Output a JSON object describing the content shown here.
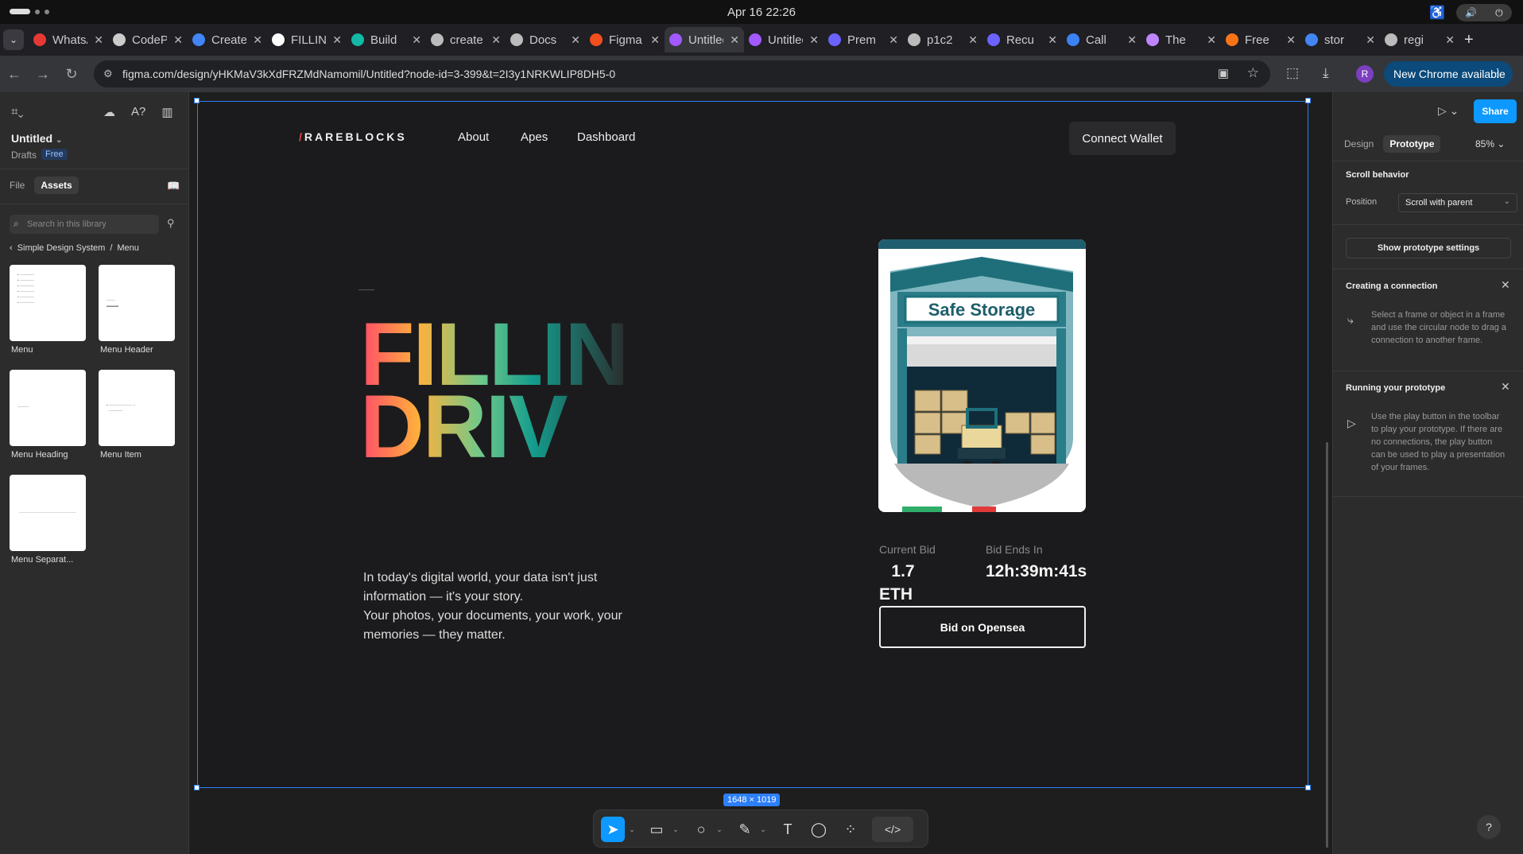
{
  "os": {
    "clock": "Apr 16  22:26"
  },
  "browser": {
    "tabs": [
      {
        "title": "WhatsApp",
        "color": "#e53935"
      },
      {
        "title": "CodePen",
        "color": "#cccccc"
      },
      {
        "title": "Create",
        "color": "#4285f4"
      },
      {
        "title": "FILLIN",
        "color": "#ffffff"
      },
      {
        "title": "Build",
        "color": "#14b8a6"
      },
      {
        "title": "create",
        "color": "#bbbbbb"
      },
      {
        "title": "Docs",
        "color": "#bbbbbb"
      },
      {
        "title": "Figma",
        "color": "#f24e1e"
      },
      {
        "title": "Untitled",
        "color": "#a259ff"
      },
      {
        "title": "Untitled",
        "color": "#a259ff"
      },
      {
        "title": "Prem",
        "color": "#6c63ff"
      },
      {
        "title": "p1c2",
        "color": "#bbbbbb"
      },
      {
        "title": "Recu",
        "color": "#6c63ff"
      },
      {
        "title": "Call",
        "color": "#3b82f6"
      },
      {
        "title": "The",
        "color": "#c084fc"
      },
      {
        "title": "Free",
        "color": "#f97316"
      },
      {
        "title": "stor",
        "color": "#4285f4"
      },
      {
        "title": "regi",
        "color": "#bbbbbb"
      }
    ],
    "active_tab_index": 8,
    "url": "figma.com/design/yHKMaV3kXdFRZMdNamomil/Untitled?node-id=3-399&t=2I3y1NRKWLIP8DH5-0",
    "avatar_letter": "R",
    "new_chrome_label": "New Chrome available"
  },
  "left_panel": {
    "file_name": "Untitled",
    "drafts_label": "Drafts",
    "plan_badge": "Free",
    "tab_file": "File",
    "tab_assets": "Assets",
    "search_placeholder": "Search in this library",
    "breadcrumb_lib": "Simple Design System",
    "breadcrumb_sep": "/",
    "breadcrumb_page": "Menu",
    "assets": [
      {
        "label": "Menu"
      },
      {
        "label": "Menu Header"
      },
      {
        "label": "Menu Heading"
      },
      {
        "label": "Menu Item"
      },
      {
        "label": "Menu Separat..."
      }
    ]
  },
  "design": {
    "brand_slash": "/",
    "brand": "RAREBLOCKS",
    "nav": [
      "About",
      "Apes",
      "Dashboard"
    ],
    "wallet_button": "Connect Wallet",
    "hero_line1": "FILLIN",
    "hero_line2": "DRIV",
    "hero_text": "In today's digital world, your data isn't just information — it's your story.\nYour photos, your documents, your work, your memories — they matter.",
    "nft_title": "Safe Storage",
    "current_bid_label": "Current Bid",
    "current_bid_value_1": "1.7",
    "current_bid_value_2": "ETH",
    "bid_ends_label": "Bid Ends In",
    "bid_ends_value": "12h:39m:41s",
    "bid_button": "Bid on Opensea",
    "frame_size": "1648 × 1019"
  },
  "right_panel": {
    "share_button": "Share",
    "tab_design": "Design",
    "tab_prototype": "Prototype",
    "zoom": "85%",
    "scroll_heading": "Scroll behavior",
    "position_label": "Position",
    "position_value": "Scroll with parent",
    "prototype_settings_button": "Show prototype settings",
    "connection_heading": "Creating a connection",
    "connection_text": "Select a frame or object in a frame and use the circular node to drag a connection to another frame.",
    "running_heading": "Running your prototype",
    "running_text": "Use the play button in the toolbar to play your prototype. If there are no connections, the play button can be used to play a presentation of your frames.",
    "help_label": "?"
  }
}
